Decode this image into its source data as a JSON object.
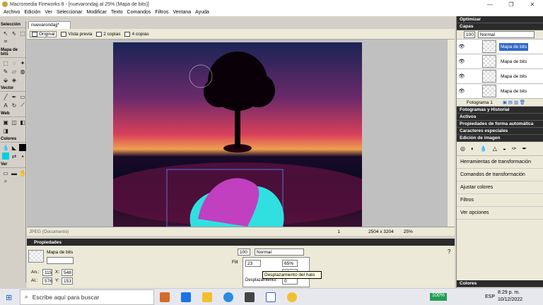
{
  "window": {
    "title": "Macromedia Fireworks 8 - [nuevarondajj al  25% (Mapa de bits)]"
  },
  "menu": [
    "Archivo",
    "Edición",
    "Ver",
    "Seleccionar",
    "Modificar",
    "Texto",
    "Comandos",
    "Filtros",
    "Ventana",
    "Ayuda"
  ],
  "tools": {
    "sections": [
      "Selección",
      "Mapa de bits",
      "Vector",
      "Web",
      "Colores",
      "Ver"
    ]
  },
  "document": {
    "tab": "nuevarondajj*",
    "views": [
      "Original",
      "Vista previa",
      "2 copias",
      "4 copias"
    ],
    "status_left": "JPEG (Documento)",
    "frame": "1",
    "size": "2504 x 3204",
    "zoom": "25%"
  },
  "properties": {
    "header": "Propiedades",
    "object_type": "Mapa de bits",
    "width_label": "An.:",
    "width": "115",
    "height_label": "Al.:",
    "height": "576",
    "x_label": "X:",
    "x": "548",
    "y_label": "Y:",
    "y": "153",
    "opacity": "100",
    "blend": "Normal",
    "filters_label": "Filt",
    "value1": "23",
    "value2": "65%",
    "value3": "12",
    "value4": "0",
    "desplazamiento_label": "Desplazamiento:",
    "tooltip": "Desplazamiento del halo"
  },
  "panels": {
    "optimizar": "Optimizar",
    "capas": "Capas",
    "layer_opacity": "100",
    "layer_blend": "Normal",
    "layers": [
      {
        "name": "Mapa de bits",
        "selected": true
      },
      {
        "name": "Mapa de bits",
        "selected": false
      },
      {
        "name": "Mapa de bits",
        "selected": false
      },
      {
        "name": "Mapa de bits",
        "selected": false
      }
    ],
    "fotograma": "Fotograma 1",
    "collapsed": [
      "Fotogramas y Historial",
      "Activos",
      "Propiedades de forma automática",
      "Caracteres especiales"
    ],
    "edicion": "Edición de imagen",
    "items": [
      "Herramientas de transformación",
      "Comandos de transformación",
      "Ajustar colores",
      "Filtros",
      "Ver opciones"
    ],
    "colores": "Colores"
  },
  "taskbar": {
    "search_placeholder": "Escribe aquí para buscar",
    "battery": "100%",
    "lang": "ESP",
    "time": "8:29 p. m.",
    "date": "10/12/2022"
  }
}
